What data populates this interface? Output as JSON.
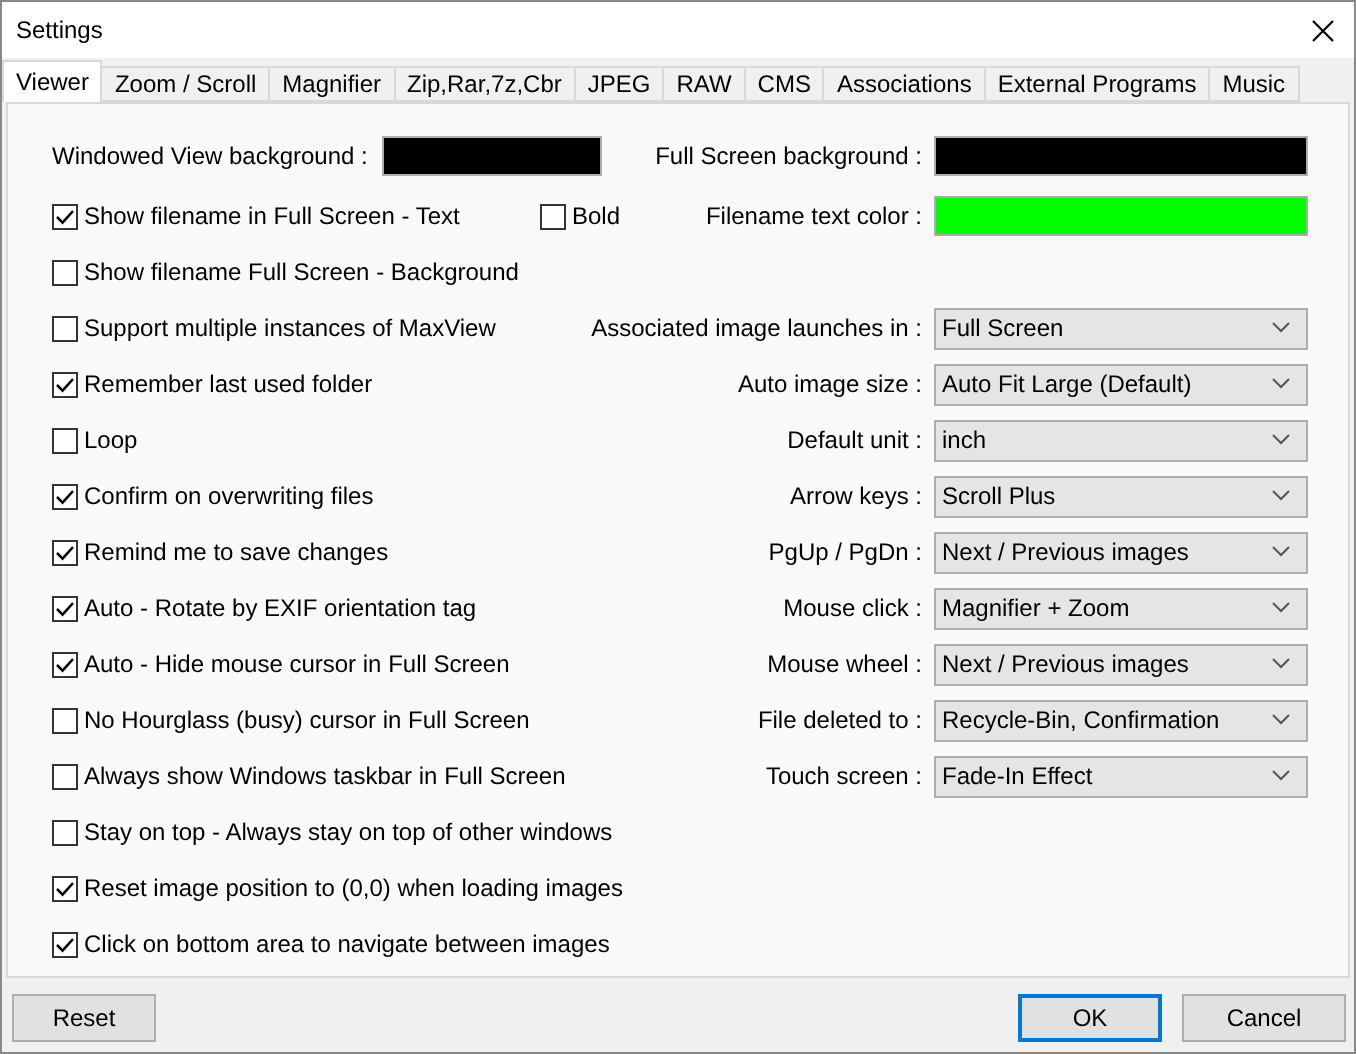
{
  "window": {
    "title": "Settings"
  },
  "tabs": [
    {
      "label": "Viewer",
      "selected": true
    },
    {
      "label": "Zoom / Scroll",
      "selected": false
    },
    {
      "label": "Magnifier",
      "selected": false
    },
    {
      "label": "Zip,Rar,7z,Cbr",
      "selected": false
    },
    {
      "label": "JPEG",
      "selected": false
    },
    {
      "label": "RAW",
      "selected": false
    },
    {
      "label": "CMS",
      "selected": false
    },
    {
      "label": "Associations",
      "selected": false
    },
    {
      "label": "External Programs",
      "selected": false
    },
    {
      "label": "Music",
      "selected": false
    }
  ],
  "backgrounds": {
    "windowed": {
      "label": "Windowed View background :",
      "color": "#000000"
    },
    "fullscreen": {
      "label": "Full Screen background :",
      "color": "#000000"
    }
  },
  "filename_text": {
    "label": "Show filename in Full Screen - Text",
    "checked": true
  },
  "bold": {
    "label": "Bold",
    "checked": false
  },
  "filename_color": {
    "label": "Filename text color :",
    "color": "#00ff00"
  },
  "options": [
    {
      "label": "Show filename Full Screen - Background",
      "checked": false
    },
    {
      "label": "Support multiple instances of MaxView",
      "checked": false
    },
    {
      "label": "Remember last used folder",
      "checked": true
    },
    {
      "label": "Loop",
      "checked": false
    },
    {
      "label": "Confirm on overwriting files",
      "checked": true
    },
    {
      "label": "Remind me to save changes",
      "checked": true
    },
    {
      "label": "Auto - Rotate by EXIF orientation tag",
      "checked": true
    },
    {
      "label": "Auto - Hide mouse cursor in Full Screen",
      "checked": true
    },
    {
      "label": "No Hourglass (busy) cursor in Full Screen",
      "checked": false
    },
    {
      "label": "Always show Windows taskbar in Full Screen",
      "checked": false
    },
    {
      "label": "Stay on top - Always stay on top of other windows",
      "checked": false
    },
    {
      "label": "Reset image position to (0,0) when loading images",
      "checked": true
    },
    {
      "label": "Click on bottom area to navigate between images",
      "checked": true
    }
  ],
  "dropdowns": [
    {
      "label": "Associated image launches in :",
      "value": "Full Screen"
    },
    {
      "label": "Auto image size :",
      "value": "Auto Fit Large (Default)"
    },
    {
      "label": "Default unit :",
      "value": "inch"
    },
    {
      "label": "Arrow keys :",
      "value": "Scroll Plus"
    },
    {
      "label": "PgUp / PgDn :",
      "value": "Next / Previous images"
    },
    {
      "label": "Mouse click :",
      "value": "Magnifier + Zoom"
    },
    {
      "label": "Mouse wheel :",
      "value": "Next / Previous images"
    },
    {
      "label": "File deleted to :",
      "value": "Recycle-Bin, Confirmation"
    },
    {
      "label": "Touch screen :",
      "value": "Fade-In Effect"
    }
  ],
  "buttons": [
    {
      "label": "Reset",
      "kind": "left",
      "default": false
    },
    {
      "label": "OK",
      "kind": "right",
      "default": true
    },
    {
      "label": "Cancel",
      "kind": "right",
      "default": false
    }
  ]
}
